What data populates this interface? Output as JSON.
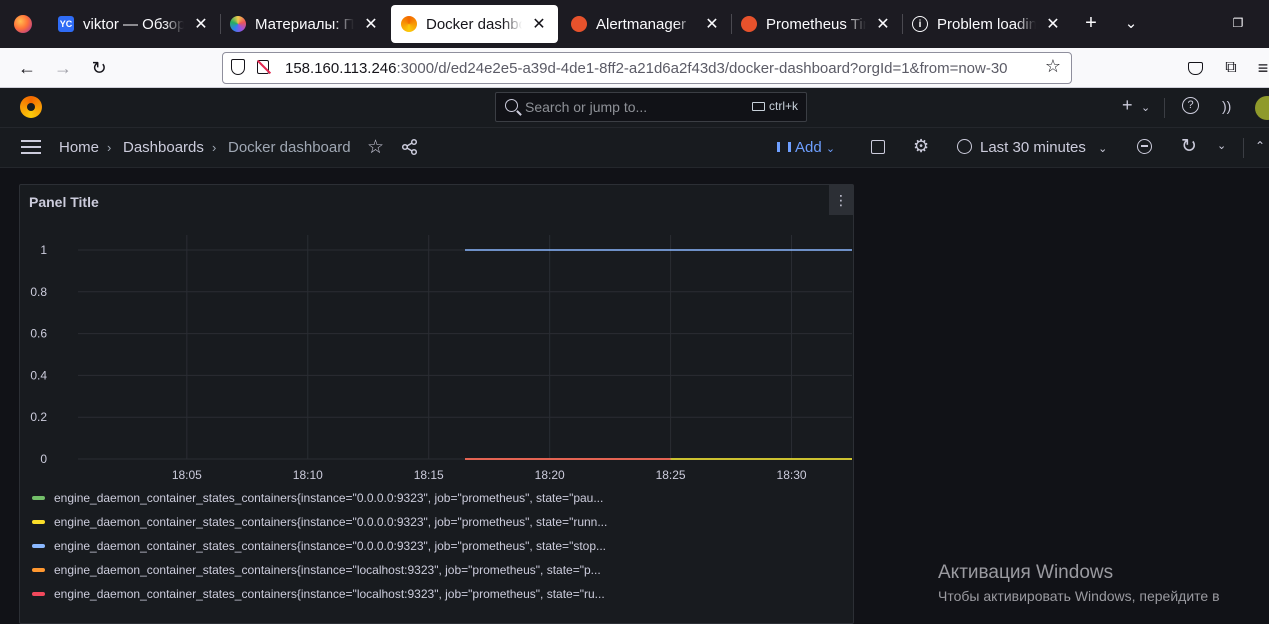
{
  "browser": {
    "tabs": [
      {
        "title": "viktor — Обзор | ",
        "favicon": "yandex-cloud-icon",
        "fav_text": "YC",
        "color": "#2f6cf6"
      },
      {
        "title": "Материалы: Пре",
        "favicon": "materials-icon",
        "fav_text": "",
        "color": "#9b51e0"
      },
      {
        "title": "Docker dashboar",
        "favicon": "grafana-icon",
        "fav_text": "",
        "color": "#f46800"
      },
      {
        "title": "Alertmanager",
        "favicon": "prometheus-icon",
        "fav_text": "",
        "color": "#e6522c"
      },
      {
        "title": "Prometheus Time",
        "favicon": "prometheus-icon",
        "fav_text": "",
        "color": "#e6522c"
      },
      {
        "title": "Problem loading",
        "favicon": "info-icon",
        "fav_text": "",
        "color": "#5b5b66"
      }
    ],
    "url_host": "158.160.113.246",
    "url_rest": ":3000/d/ed24e2e5-a39d-4de1-8ff2-a21d6a2f43d3/docker-dashboard?orgId=1&from=now-30"
  },
  "grafana": {
    "search_placeholder": "Search or jump to...",
    "search_shortcut": "ctrl+k",
    "breadcrumb": [
      "Home",
      "Dashboards",
      "Docker dashboard"
    ],
    "add_label": "Add",
    "time_range": "Last 30 minutes"
  },
  "panel": {
    "title": "Panel Title"
  },
  "chart_data": {
    "type": "line",
    "title": "Panel Title",
    "xlabel": "",
    "ylabel": "",
    "ylim": [
      0,
      1
    ],
    "yticks": [
      "0",
      "0.2",
      "0.4",
      "0.6",
      "0.8",
      "1"
    ],
    "xticks": [
      "18:05",
      "18:10",
      "18:15",
      "18:20",
      "18:25",
      "18:30"
    ],
    "grid": true,
    "legend_position": "bottom",
    "series": [
      {
        "name": "engine_daemon_container_states_containers{instance=\"0.0.0.0:9323\", job=\"prometheus\", state=\"pau...",
        "color": "#73bf69",
        "x": [
          "18:16:30",
          "18:32:30"
        ],
        "y": [
          0,
          0
        ]
      },
      {
        "name": "engine_daemon_container_states_containers{instance=\"0.0.0.0:9323\", job=\"prometheus\", state=\"runn...",
        "color": "#fade2a",
        "x": [
          "18:16:30",
          "18:32:30"
        ],
        "y": [
          0,
          0
        ]
      },
      {
        "name": "engine_daemon_container_states_containers{instance=\"0.0.0.0:9323\", job=\"prometheus\", state=\"stop...",
        "color": "#8ab8ff",
        "x": [
          "18:16:30",
          "18:32:30"
        ],
        "y": [
          1,
          1
        ]
      },
      {
        "name": "engine_daemon_container_states_containers{instance=\"localhost:9323\", job=\"prometheus\", state=\"p...",
        "color": "#ff9830",
        "x": [
          "18:16:30",
          "18:25:00"
        ],
        "y": [
          0,
          0
        ]
      },
      {
        "name": "engine_daemon_container_states_containers{instance=\"localhost:9323\", job=\"prometheus\", state=\"ru...",
        "color": "#f2495c",
        "x": [
          "18:16:30",
          "18:25:00"
        ],
        "y": [
          0,
          0
        ]
      }
    ]
  },
  "watermark": {
    "line1": "Активация Windows",
    "line2": "Чтобы активировать Windows, перейдите в"
  }
}
